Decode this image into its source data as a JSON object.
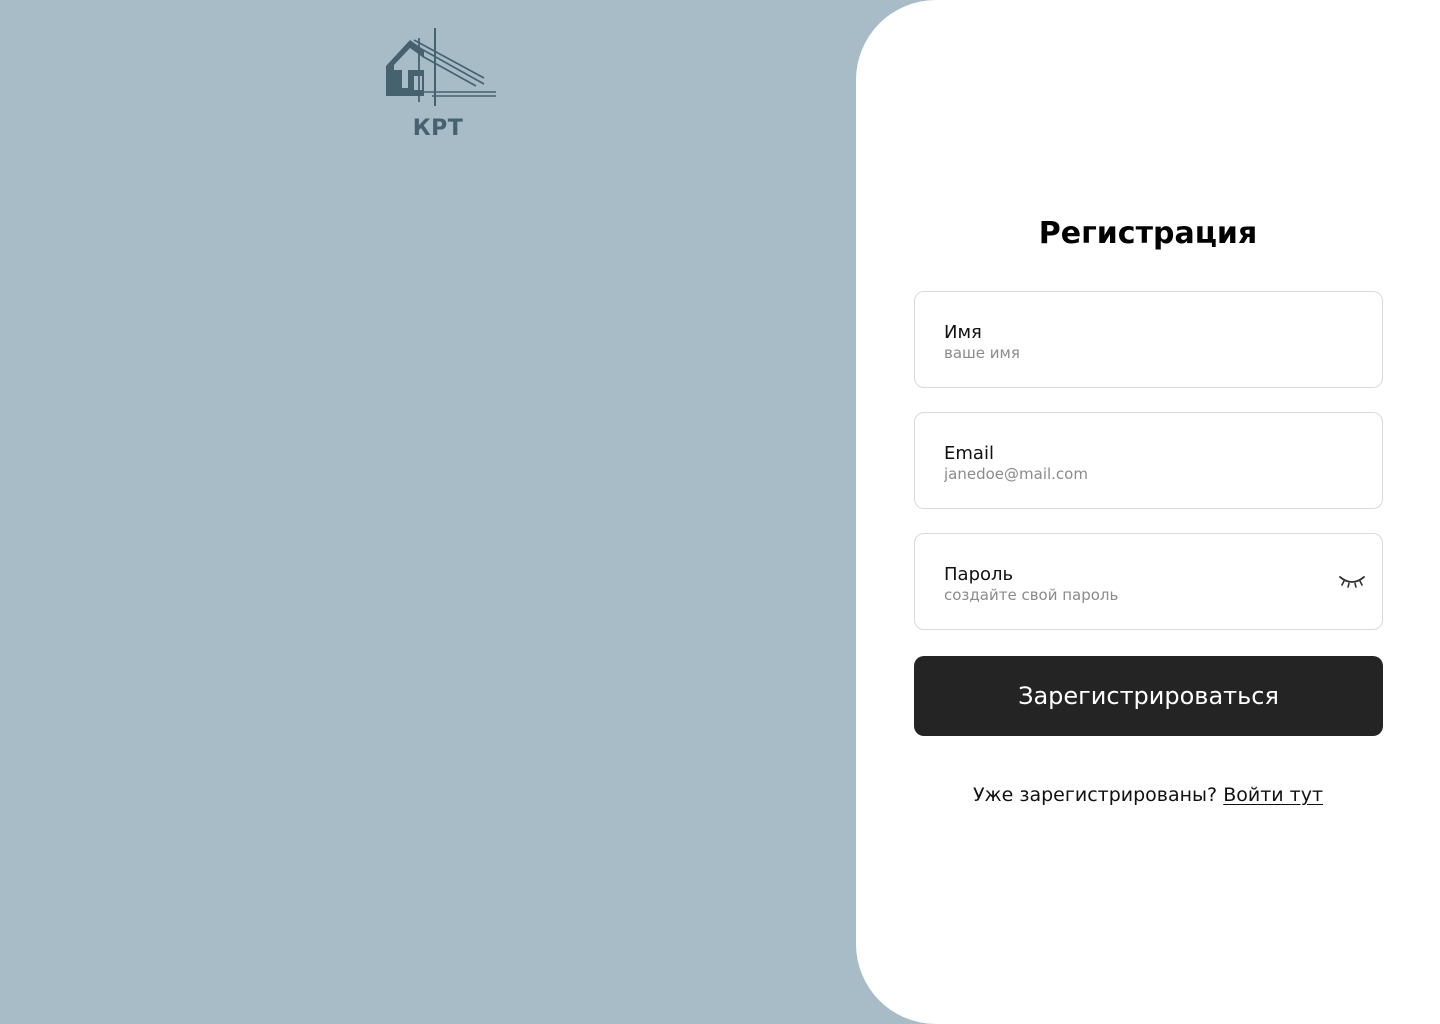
{
  "brand": {
    "name": "КРТ",
    "logo_icon": "house-roof-logo-icon",
    "color": "#46626e"
  },
  "colors": {
    "background": "#a7bcc7",
    "panel": "#ffffff",
    "button": "#242424",
    "field_border": "#d9d9d9",
    "placeholder": "#8b8b8b"
  },
  "form": {
    "title": "Регистрация",
    "name_field": {
      "label": "Имя",
      "placeholder": "ваше имя"
    },
    "email_field": {
      "label": "Email",
      "placeholder": "janedoe@mail.com"
    },
    "password_field": {
      "label": "Пароль",
      "placeholder": "создайте свой пароль",
      "toggle_icon": "eye-closed-icon"
    },
    "submit_label": "Зарегистрироваться",
    "login_prompt": "Уже зарегистрированы?",
    "login_link": "Войти тут"
  }
}
